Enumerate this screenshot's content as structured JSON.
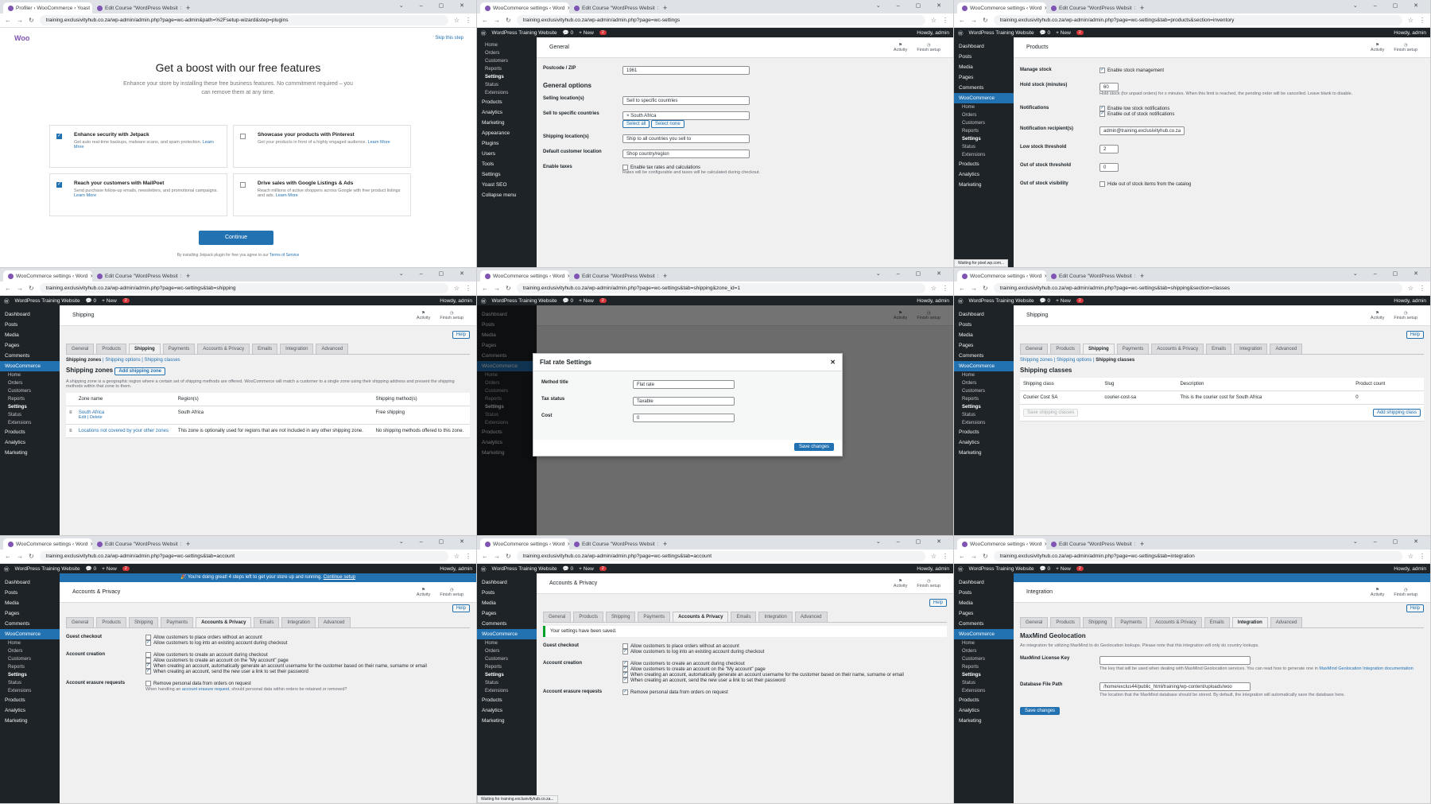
{
  "panes": [
    {
      "id": "p1",
      "tabs": [
        "Profiler ‹ WooCommerce ‹ Yoast",
        "Edit Course \"WordPress Websit"
      ],
      "url": "training.exclusivityhub.co.za/wp-admin/admin.php?page=wc-admin&path=%2Fsetup-wizard&step=plugins",
      "wizard": {
        "logo": "Woo",
        "skip": "Skip this step",
        "title": "Get a boost with our free features",
        "subtitle": "Enhance your store by installing these free business features. No commitment required – you can remove them at any time.",
        "features": [
          {
            "title": "Enhance security with Jetpack",
            "desc": "Get auto real-time backups, malware scans, and spam protection.",
            "link": "Learn More",
            "checked": true
          },
          {
            "title": "Showcase your products with Pinterest",
            "desc": "Get your products in front of a highly engaged audience.",
            "link": "Learn More",
            "checked": false
          },
          {
            "title": "Reach your customers with MailPoet",
            "desc": "Send purchase follow-up emails, newsletters, and promotional campaigns.",
            "link": "Learn More",
            "checked": true
          },
          {
            "title": "Drive sales with Google Listings & Ads",
            "desc": "Reach millions of active shoppers across Google with free product listings and ads.",
            "link": "Learn More",
            "checked": false
          }
        ],
        "continue": "Continue",
        "footer": "By installing Jetpack plugin for free you agree to our",
        "footer_link": "Terms of Service"
      }
    },
    {
      "id": "p2",
      "tabs": [
        "WooCommerce settings ‹ Word",
        "Edit Course \"WordPress Websit"
      ],
      "url": "training.exclusivityhub.co.za/wp-admin/admin.php?page=wc-settings",
      "page_title": "General",
      "postcode_label": "Postcode / ZIP",
      "postcode": "1961",
      "section": "General options",
      "fields": [
        {
          "label": "Selling location(s)",
          "value": "Sell to specific countries"
        },
        {
          "label": "Sell to specific countries",
          "value": "× South Africa"
        },
        {
          "label": "Shipping location(s)",
          "value": "Ship to all countries you sell to"
        },
        {
          "label": "Default customer location",
          "value": "Shop country/region"
        }
      ],
      "select_all": "Select all",
      "select_none": "Select none",
      "taxes_label": "Enable taxes",
      "taxes_check": "Enable tax rates and calculations",
      "taxes_help": "Rates will be configurable and taxes will be calculated during checkout.",
      "side": [
        "Home",
        "Orders",
        "Customers",
        "Reports",
        "Settings",
        "Status",
        "Extensions",
        "Products",
        "Analytics",
        "Marketing",
        "Appearance",
        "Plugins",
        "Users",
        "Tools",
        "Settings",
        "Yoast SEO",
        "Collapse menu"
      ]
    },
    {
      "id": "p3",
      "tabs": [
        "WooCommerce settings ‹ Word",
        "Edit Course \"WordPress Websit"
      ],
      "url": "training.exclusivityhub.co.za/wp-admin/admin.php?page=wc-settings&tab=products&section=inventory",
      "page_title": "Products",
      "rows": [
        {
          "label": "Manage stock",
          "check": "Enable stock management"
        },
        {
          "label": "Hold stock (minutes)",
          "value": "60",
          "help": "Hold stock (for unpaid orders) for x minutes. When this limit is reached, the pending order will be cancelled. Leave blank to disable."
        },
        {
          "label": "Notifications",
          "check": "Enable low stock notifications",
          "check2": "Enable out of stock notifications"
        },
        {
          "label": "Notification recipient(s)",
          "value": "admin@training.exclusivityhub.co.za"
        },
        {
          "label": "Low stock threshold",
          "value": "2"
        },
        {
          "label": "Out of stock threshold",
          "value": "0"
        },
        {
          "label": "Out of stock visibility",
          "check": "Hide out of stock items from the catalog"
        }
      ],
      "status": "Waiting for pixel.wp.com..."
    },
    {
      "id": "p4",
      "tabs": [
        "WooCommerce settings ‹ Word",
        "Edit Course \"WordPress Websit"
      ],
      "url": "training.exclusivityhub.co.za/wp-admin/admin.php?page=wc-settings&tab=shipping",
      "page_title": "Shipping",
      "subnav": [
        "Shipping zones",
        "Shipping options",
        "Shipping classes"
      ],
      "heading": "Shipping zones",
      "add_btn": "Add shipping zone",
      "intro": "A shipping zone is a geographic region where a certain set of shipping methods are offered. WooCommerce will match a customer to a single zone using their shipping address and present the shipping methods within that zone to them.",
      "cols": [
        "Zone name",
        "Region(s)",
        "Shipping method(s)"
      ],
      "zones": [
        {
          "name": "South Africa",
          "actions": "Edit | Delete",
          "region": "South Africa",
          "method": "Free shipping"
        },
        {
          "name": "Locations not covered by your other zones",
          "actions": "",
          "region": "This zone is optionally used for regions that are not included in any other shipping zone.",
          "method": "No shipping methods offered to this zone."
        }
      ]
    },
    {
      "id": "p5",
      "tabs": [
        "WooCommerce settings ‹ Word",
        "Edit Course \"WordPress Websit"
      ],
      "url": "training.exclusivityhub.co.za/wp-admin/admin.php?page=wc-settings&tab=shipping&zone_id=1",
      "modal": {
        "title": "Flat rate Settings",
        "fields": [
          {
            "label": "Method title",
            "value": "Flat rate"
          },
          {
            "label": "Tax status",
            "value": "Taxable"
          },
          {
            "label": "Cost",
            "value": "0"
          }
        ],
        "save": "Save changes"
      }
    },
    {
      "id": "p6",
      "tabs": [
        "WooCommerce settings ‹ Word",
        "Edit Course \"WordPress Websit"
      ],
      "url": "training.exclusivityhub.co.za/wp-admin/admin.php?page=wc-settings&tab=shipping&section=classes",
      "page_title": "Shipping",
      "subnav": [
        "Shipping zones",
        "Shipping options",
        "Shipping classes"
      ],
      "heading": "Shipping classes",
      "cols": [
        "Shipping class",
        "Slug",
        "Description",
        "Product count"
      ],
      "row": {
        "name": "Courier Cost SA",
        "slug": "courier-cost-sa",
        "desc": "This is the courier cost for South Africa",
        "count": "0"
      },
      "save": "Save shipping classes",
      "add": "Add shipping class"
    },
    {
      "id": "p7",
      "tabs": [
        "WooCommerce settings ‹ Word",
        "Edit Course \"WordPress Websit"
      ],
      "url": "training.exclusivityhub.co.za/wp-admin/admin.php?page=wc-settings&tab=account",
      "notice": "🎉 You're doing great! 4 steps left to get your store up and running.",
      "notice_link": "Continue setup",
      "page_title": "Accounts & Privacy",
      "guest_label": "Guest checkout",
      "guest": [
        "Allow customers to place orders without an account",
        "Allow customers to log into an existing account during checkout"
      ],
      "creation_label": "Account creation",
      "creation": [
        "Allow customers to create an account during checkout",
        "Allow customers to create an account on the \"My account\" page",
        "When creating an account, automatically generate an account username for the customer based on their name, surname or email",
        "When creating an account, send the new user a link to set their password"
      ],
      "erasure_label": "Account erasure requests",
      "erasure": "Remove personal data from orders on request",
      "erasure_help": "When handling an",
      "erasure_link": "account erasure request",
      "erasure_help2": ", should personal data within orders be retained or removed?"
    },
    {
      "id": "p8",
      "tabs": [
        "WooCommerce settings ‹ Word",
        "Edit Course \"WordPress Websit"
      ],
      "url": "training.exclusivityhub.co.za/wp-admin/admin.php?page=wc-settings&tab=account",
      "page_title": "Accounts & Privacy",
      "saved": "Your settings have been saved.",
      "status": "Waiting for training.exclusivityhub.co.za..."
    },
    {
      "id": "p9",
      "tabs": [
        "WooCommerce settings ‹ Word",
        "Edit Course \"WordPress Websit"
      ],
      "url": "training.exclusivityhub.co.za/wp-admin/admin.php?page=wc-settings&tab=integration",
      "page_title": "Integration",
      "heading": "MaxMind Geolocation",
      "intro": "An integration for utilizing MaxMind to do Geolocation lookups. Please note that this integration will only do country lookups.",
      "key_label": "MaxMind License Key",
      "key_help": "The key that will be used when dealing with MaxMind Geolocation services. You can read how to generate one in",
      "key_link": "MaxMind Geolocation Integration documentation",
      "db_label": "Database File Path",
      "db_value": "/home/exclus44/public_html/training/wp-content/uploads/woo",
      "db_help": "The location that the MaxMind database should be stored. By default, the integration will automatically save the database here.",
      "save": "Save changes"
    }
  ],
  "common": {
    "site": "WordPress Training Website",
    "new": "New",
    "howdy": "Howdy, admin",
    "comments_count": "0",
    "updates": "2",
    "settings_tabs": [
      "General",
      "Products",
      "Shipping",
      "Payments",
      "Accounts & Privacy",
      "Emails",
      "Integration",
      "Advanced"
    ],
    "activity": "Activity",
    "finish": "Finish setup",
    "help": "Help",
    "side_full": [
      "Dashboard",
      "Posts",
      "Media",
      "Pages",
      "Comments",
      "WooCommerce",
      "Home",
      "Orders",
      "Customers",
      "Reports",
      "Settings",
      "Status",
      "Extensions",
      "Products",
      "Analytics",
      "Marketing"
    ],
    "home_badge": "4"
  },
  "colors": {
    "wp_blue": "#2271b1",
    "admin_dark": "#1d2327",
    "woo_purple": "#7f54b3"
  }
}
